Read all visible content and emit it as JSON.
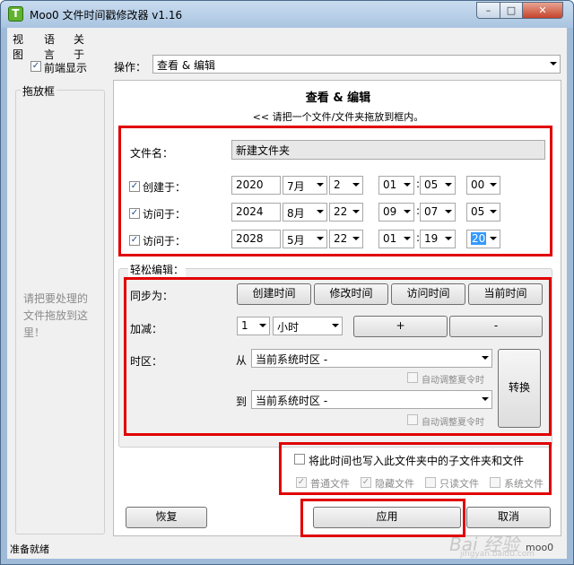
{
  "window": {
    "title": "Moo0 文件时间戳修改器 v1.16",
    "app_icon_letter": "T"
  },
  "menu": {
    "items": [
      "视图",
      "语言",
      "关于"
    ]
  },
  "topbar": {
    "always_on_top_label": "前端显示",
    "operation_label": "操作：",
    "operation_value": "查看 & 编辑"
  },
  "dropzone": {
    "title": "拖放框",
    "hint": "请把要处理的文件拖放到这里！"
  },
  "view_edit": {
    "heading": "查看 & 编辑",
    "subheading": "<< 请把一个文件/文件夹拖放到框内。",
    "filename_label": "文件名：",
    "filename_value": "新建文件夹",
    "rows": [
      {
        "label": "创建于：",
        "year": "2020",
        "month": "7月",
        "day": "2",
        "hour": "01",
        "minute": "05",
        "second": "00"
      },
      {
        "label": "访问于：",
        "year": "2024",
        "month": "8月",
        "day": "22",
        "hour": "09",
        "minute": "07",
        "second": "05"
      },
      {
        "label": "访问于：",
        "year": "2028",
        "month": "5月",
        "day": "22",
        "hour": "01",
        "minute": "19",
        "second": "20"
      }
    ]
  },
  "easy_edit": {
    "title": "轻松编辑：",
    "sync_label": "同步为：",
    "sync_buttons": [
      "创建时间",
      "修改时间",
      "访问时间",
      "当前时间"
    ],
    "add_label": "加减：",
    "add_amount": "1",
    "add_unit": "小时",
    "plus_label": "+",
    "minus_label": "-",
    "timezone_label": "时区：",
    "from_label": "从",
    "from_value": "当前系统时区 -",
    "to_label": "到",
    "to_value": "当前系统时区 -",
    "dst_label": "自动调整夏令时",
    "convert_label": "转换"
  },
  "subfolders": {
    "main_label": "将此时间也写入此文件夹中的子文件夹和文件",
    "options": [
      "普通文件",
      "隐藏文件",
      "只读文件",
      "系统文件"
    ]
  },
  "actions": {
    "restore_label": "恢复",
    "apply_label": "应用",
    "cancel_label": "取消"
  },
  "status": {
    "text": "准备就绪",
    "brand": "moo0"
  },
  "watermark": {
    "text": "Bai 经验",
    "sub": "jingyan.baidu.com"
  }
}
